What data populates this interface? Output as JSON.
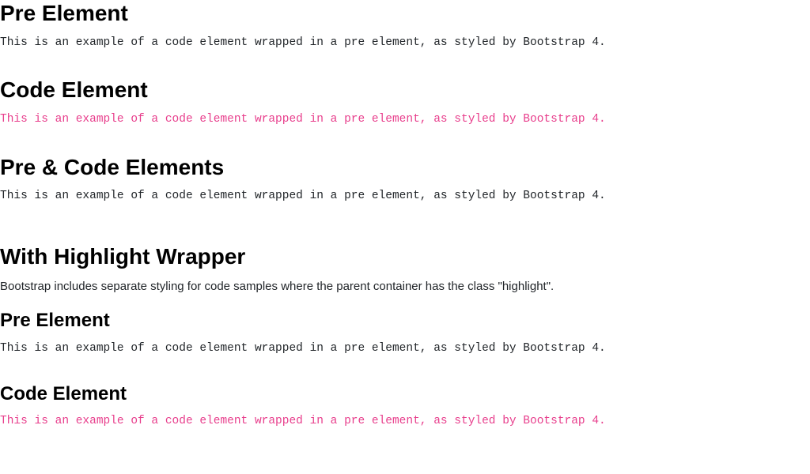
{
  "sections": {
    "pre": {
      "heading": "Pre Element",
      "sample": "This is an example of a code element wrapped in a pre element, as styled by Bootstrap 4."
    },
    "code": {
      "heading": "Code Element",
      "sample": "This is an example of a code element wrapped in a pre element, as styled by Bootstrap 4."
    },
    "pre_code": {
      "heading": "Pre & Code Elements",
      "sample": "This is an example of a code element wrapped in a pre element, as styled by Bootstrap 4."
    },
    "highlight": {
      "heading": "With Highlight Wrapper",
      "desc": "Bootstrap includes separate styling for code samples where the parent container has the class \"highlight\"."
    },
    "hl_pre": {
      "heading": "Pre Element",
      "sample": "This is an example of a code element wrapped in a pre element, as styled by Bootstrap 4."
    },
    "hl_code": {
      "heading": "Code Element",
      "sample": "This is an example of a code element wrapped in a pre element, as styled by Bootstrap 4."
    }
  }
}
